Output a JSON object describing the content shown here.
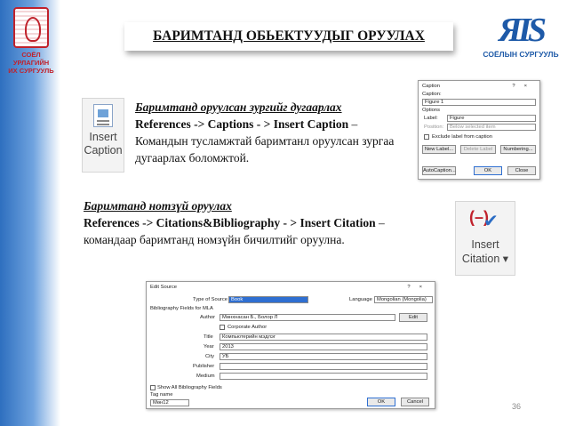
{
  "slide": {
    "title": "БАРИМТАНД ОБЬЕКТУУДЫГ ОРУУЛАХ",
    "page_number": "36",
    "accent_color": "#1e5aa8",
    "left_bar_color": "#2e6fbf"
  },
  "left_logo": {
    "text_line1": "СОЁЛ УРЛАГИЙН",
    "text_line2": "ИХ СУРГУУЛЬ"
  },
  "right_logo": {
    "mark": "ЯIS",
    "org_name": "СОЁЛЫН СУРГУУЛЬ"
  },
  "caption_section": {
    "ribbon_button_label_1": "Insert",
    "ribbon_button_label_2": "Caption",
    "heading": "Баримтанд оруулсан зургийг дугаарлах",
    "command": "References -> Captions - > Insert Caption",
    "dash": " –",
    "description": "Командын тусламжтай баримтанл оруулсан зургаа дугаарлах боломжтой."
  },
  "citation_section": {
    "ribbon_button_label_1": "Insert",
    "ribbon_button_label_2": "Citation",
    "dropdown_arrow": "▾",
    "heading": "Баримтанд нотзүй оруулах",
    "command": "References -> Citations&Bibliography - > Insert Citation",
    "dash": " –",
    "description": "командаар баримтанд номзүйн бичилтийг оруулна."
  },
  "caption_dialog": {
    "title": "Caption",
    "controls": "?×",
    "caption_label": "Caption:",
    "caption_value": "Figure 1",
    "options_label": "Options",
    "label_label": "Label:",
    "label_value": "Figure",
    "position_label": "Position:",
    "position_value": "Below selected item",
    "exclude_label": "Exclude label from caption",
    "new_label_button": "New Label...",
    "delete_label_button": "Delete Label",
    "numbering_button": "Numbering...",
    "autocaption_button": "AutoCaption...",
    "ok_button": "OK",
    "close_button": "Close"
  },
  "source_dialog": {
    "title": "Edit Source",
    "controls": "?×",
    "type_label": "Type of Source",
    "type_value": "Book",
    "language_label": "Language",
    "language_value": "Mongolian (Mongolia)",
    "bib_fields_label": "Bibliography Fields for MLA",
    "author_label": "Author",
    "author_value": "Мөнхнасан Б., Болор Л",
    "edit_button": "Edit",
    "corporate_author_label": "Corporate Author",
    "title_label": "Title",
    "title_value": "Компьютерийн мэдлэг",
    "year_label": "Year",
    "year_value": "2013",
    "city_label": "City",
    "city_value": "УБ",
    "publisher_label": "Publisher",
    "publisher_value": "",
    "medium_label": "Medium",
    "medium_value": "",
    "show_all_label": "Show All Bibliography Fields",
    "tag_name_label": "Tag name",
    "tag_name_value": "Мөн12",
    "ok_button": "OK",
    "cancel_button": "Cancel"
  }
}
